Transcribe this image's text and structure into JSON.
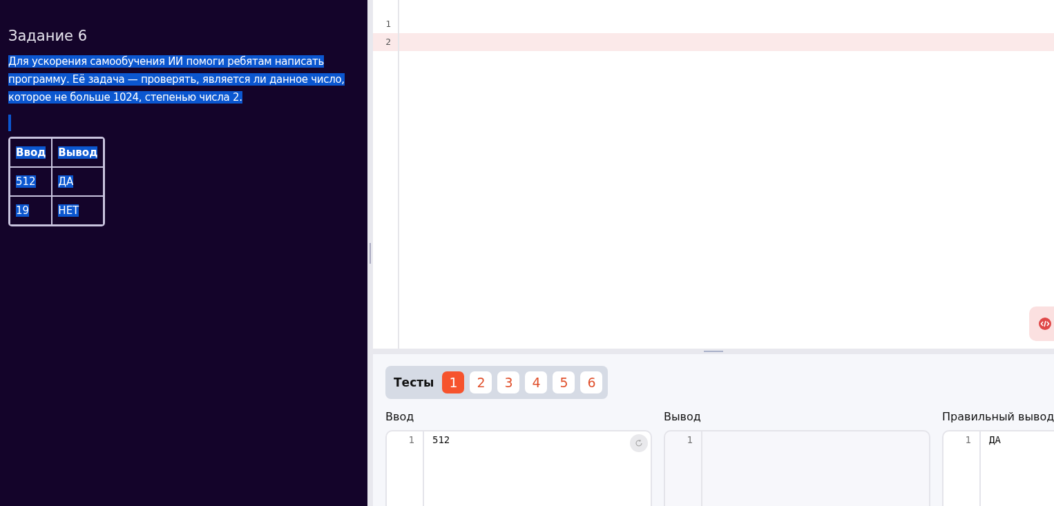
{
  "task": {
    "title": "Задание 6",
    "selected_text": true,
    "description": "Для ускорения самообучения ИИ помоги ребятам написать программу. Её задача — проверять, является ли данное число, которое не больше 1024, степенью числа 2.",
    "table": {
      "columns": [
        "Ввод",
        "Вывод"
      ],
      "rows": [
        [
          "512",
          "ДА"
        ],
        [
          "19",
          "НЕТ"
        ]
      ]
    }
  },
  "editor": {
    "lines": [
      {
        "number": "1",
        "error": false
      },
      {
        "number": "2",
        "error": true
      }
    ]
  },
  "tests": {
    "label": "Тесты",
    "items": [
      {
        "label": "1",
        "selected": true
      },
      {
        "label": "2",
        "selected": false
      },
      {
        "label": "3",
        "selected": false
      },
      {
        "label": "4",
        "selected": false
      },
      {
        "label": "5",
        "selected": false
      },
      {
        "label": "6",
        "selected": false
      }
    ]
  },
  "io": [
    {
      "kind": "input",
      "title": "Ввод",
      "lines": [
        {
          "number": "1",
          "text": "512"
        }
      ]
    },
    {
      "kind": "output",
      "title": "Вывод",
      "lines": [
        {
          "number": "1"
        }
      ]
    },
    {
      "kind": "expected",
      "title": "Правильный вывод",
      "lines": [
        {
          "number": "1",
          "text": "ДА"
        }
      ]
    }
  ]
}
